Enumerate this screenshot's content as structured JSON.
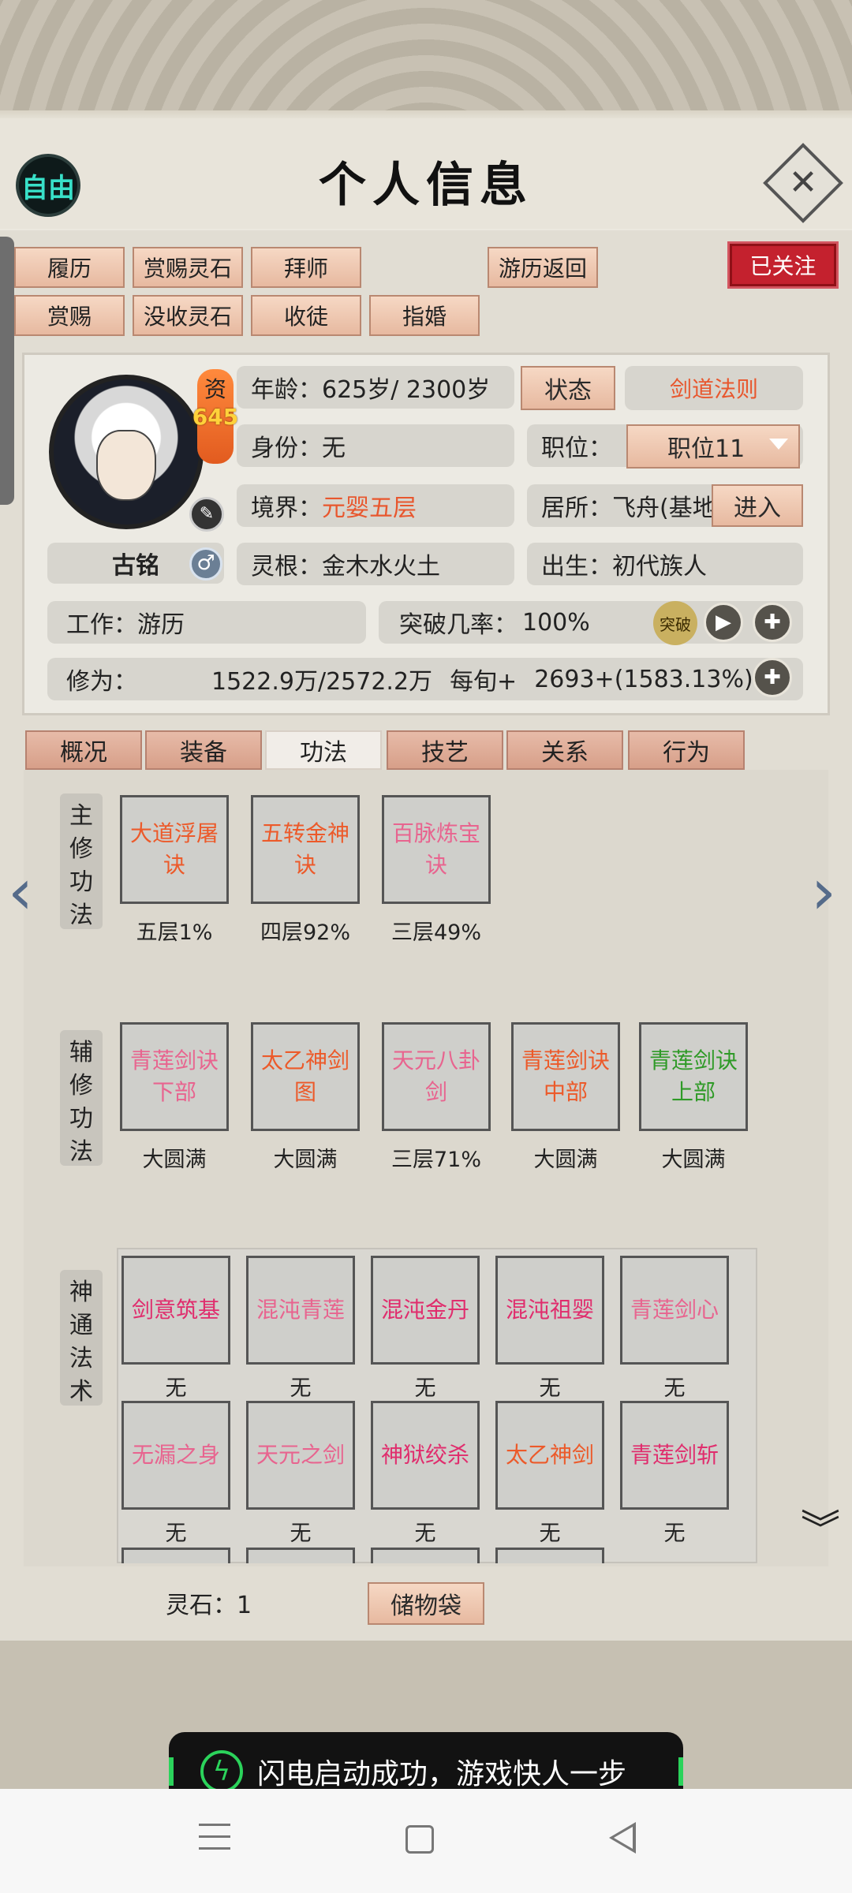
{
  "header": {
    "free_mode": "自由",
    "title": "个人信息",
    "close_icon": "close-icon"
  },
  "actions_row1": [
    "履历",
    "赏赐灵石",
    "拜师",
    "游历返回"
  ],
  "actions_row2": [
    "赏赐",
    "没收灵石",
    "收徒",
    "指婚"
  ],
  "followed": "已关注",
  "profile": {
    "talent_label": "资",
    "talent_value": "645",
    "name": "古铭",
    "gender_icon": "male-icon",
    "age_label": "年龄：",
    "age_value": "625岁/ 2300岁",
    "status_button": "状态",
    "sword_law_button": "剑道法则",
    "identity_label": "身份：",
    "identity_value": "无",
    "post_label": "职位：",
    "post_value": "职位11",
    "realm_label": "境界：",
    "realm_value": "元婴五层",
    "residence_label": "居所：",
    "residence_value": "飞舟(基地",
    "enter_button": "进入",
    "root_label": "灵根：",
    "root_value": "金木水火土",
    "birth_label": "出生：",
    "birth_value": "初代族人",
    "work_label": "工作：",
    "work_value": "游历",
    "breakthrough_label": "突破几率：",
    "breakthrough_value": "100%",
    "meditate_icon": "突破",
    "cultivation_label": "修为：",
    "cultivation_value": "1522.9万/2572.2万",
    "per_period_label": "每旬+",
    "per_period_value": "2693+(1583.13%)"
  },
  "tabs": [
    "概况",
    "装备",
    "功法",
    "技艺",
    "关系",
    "行为"
  ],
  "active_tab": "功法",
  "main_section": {
    "label": "主修功法",
    "items": [
      {
        "name": "大道浮屠诀",
        "level": "五层1%",
        "color": "#ec5a2a"
      },
      {
        "name": "五转金神诀",
        "level": "四层92%",
        "color": "#ec5a2a"
      },
      {
        "name": "百脉炼宝诀",
        "level": "三层49%",
        "color": "#e8648f"
      }
    ]
  },
  "aux_section": {
    "label": "辅修功法",
    "items": [
      {
        "name": "青莲剑诀下部",
        "level": "大圆满",
        "color": "#e8648f"
      },
      {
        "name": "太乙神剑图",
        "level": "大圆满",
        "color": "#ec5a2a"
      },
      {
        "name": "天元八卦剑",
        "level": "三层71%",
        "color": "#e8648f"
      },
      {
        "name": "青莲剑诀中部",
        "level": "大圆满",
        "color": "#ec5a2a"
      },
      {
        "name": "青莲剑诀上部",
        "level": "大圆满",
        "color": "#2f9a27"
      }
    ]
  },
  "magic_section": {
    "label": "神通法术",
    "items": [
      {
        "name": "剑意筑基",
        "level": "无",
        "color": "#e02d6d"
      },
      {
        "name": "混沌青莲",
        "level": "无",
        "color": "#e8648f"
      },
      {
        "name": "混沌金丹",
        "level": "无",
        "color": "#e02d6d"
      },
      {
        "name": "混沌祖婴",
        "level": "无",
        "color": "#e02d6d"
      },
      {
        "name": "青莲剑心",
        "level": "无",
        "color": "#e8648f"
      },
      {
        "name": "无漏之身",
        "level": "无",
        "color": "#e8648f"
      },
      {
        "name": "天元之剑",
        "level": "无",
        "color": "#e8648f"
      },
      {
        "name": "神狱绞杀",
        "level": "无",
        "color": "#e02d6d"
      },
      {
        "name": "太乙神剑",
        "level": "无",
        "color": "#ec5a2a"
      },
      {
        "name": "青莲剑斩",
        "level": "无",
        "color": "#e02d6d"
      }
    ]
  },
  "footer": {
    "spirit_stone": "灵石：1",
    "bag_button": "储物袋"
  },
  "toast": {
    "text": "闪电启动成功，游戏快人一步",
    "icon": "lightning-icon"
  },
  "navbar": {
    "menu_icon": "menu-icon",
    "home_icon": "home-icon",
    "back_icon": "back-icon"
  }
}
